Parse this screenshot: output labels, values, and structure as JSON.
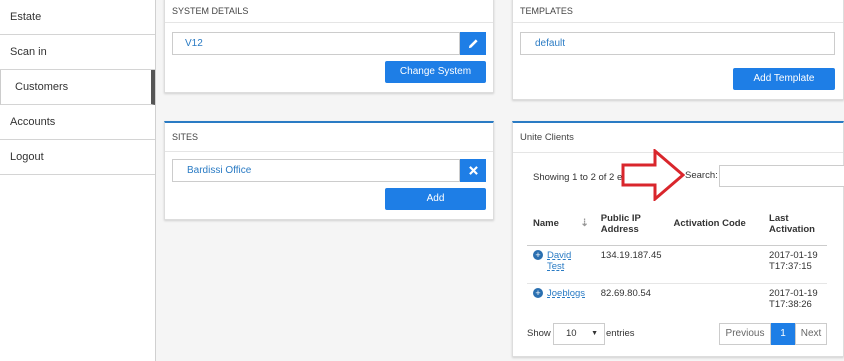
{
  "sidebar": {
    "items": [
      {
        "label": "Estate"
      },
      {
        "label": "Scan in"
      },
      {
        "label": "Customers"
      },
      {
        "label": "Accounts"
      },
      {
        "label": "Logout"
      }
    ]
  },
  "system_details": {
    "title": "SYSTEM DETAILS",
    "system_value": "V12",
    "change_button": "Change System"
  },
  "templates": {
    "title": "TEMPLATES",
    "template_value": "default",
    "add_button": "Add Template"
  },
  "sites": {
    "title": "SITES",
    "site_value": "Bardissi Office",
    "add_button": "Add"
  },
  "unite_clients": {
    "title": "Unite Clients",
    "showing": "Showing 1 to 2 of 2 entries",
    "search_label": "Search:",
    "columns": [
      "Name",
      "Public IP Address",
      "Activation Code",
      "Last Activation"
    ],
    "rows": [
      {
        "name": "David Test",
        "ip": "134.19.187.45",
        "code": "",
        "last": "2017-01-19T17:37:15"
      },
      {
        "name": "Joeblogs",
        "ip": "82.69.80.54",
        "code": "",
        "last": "2017-01-19T17:38:26"
      }
    ],
    "show_label": "Show",
    "page_size": "10",
    "entries_label": "entries",
    "pager": {
      "previous": "Previous",
      "page": "1",
      "next": "Next"
    }
  },
  "colors": {
    "accent": "#1e7ee6",
    "arrow": "#d9262c"
  }
}
